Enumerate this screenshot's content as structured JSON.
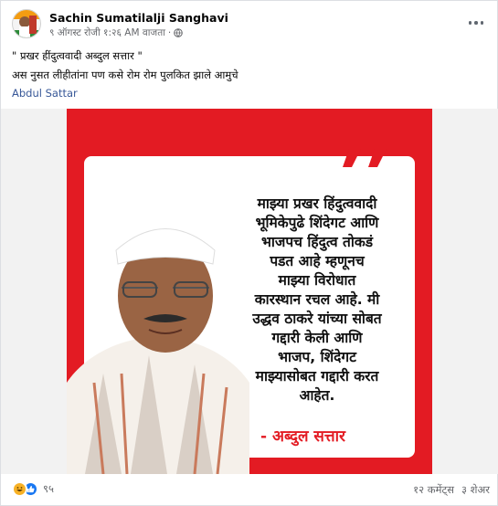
{
  "post": {
    "author": "Sachin Sumatilalji Sanghavi",
    "timestamp": "९ ऑगस्ट रोजी १:२६ AM वाजता",
    "separator": "·",
    "audience_icon": "globe-icon",
    "more_icon": "more-options-icon",
    "text_line_1": "\" प्रखर हींदुत्ववादी अब्दुल सत्तार \"",
    "text_line_2": "अस नुसत लीहीतांना पण कसे रोम रोम पुलकित झाले आमुचे",
    "tagged_person": "Abdul Sattar"
  },
  "poster": {
    "quote_lines": [
      "माझ्या प्रखर हिंदुत्ववादी",
      "भूमिकेपुढे शिंदेगट आणि",
      "भाजपच हिंदुत्व तोकडं",
      "पडत आहे म्हणूनच",
      "माझ्या विरोधात",
      "कारस्थान रचल आहे. मी",
      "उद्धव ठाकरे यांच्या सोबत",
      "गद्दारी केली आणि",
      "भाजप, शिंदेगट",
      "माझ्यासोबत गद्दारी करत",
      "आहेत."
    ],
    "signature": "- अब्दुल सत्तार",
    "colors": {
      "background": "#e31b23",
      "card": "#ffffff",
      "text": "#111111",
      "signature": "#e31b23"
    }
  },
  "footer": {
    "reaction_icons": [
      "laugh-reaction-icon",
      "like-reaction-icon"
    ],
    "reaction_count": "९५",
    "comments": "१२ कमेंट्स",
    "shares": "३ शेअर"
  },
  "colors": {
    "link": "#385898",
    "meta": "#65676b",
    "like_blue": "#1877f2",
    "laugh_yellow": "#f7b125"
  }
}
